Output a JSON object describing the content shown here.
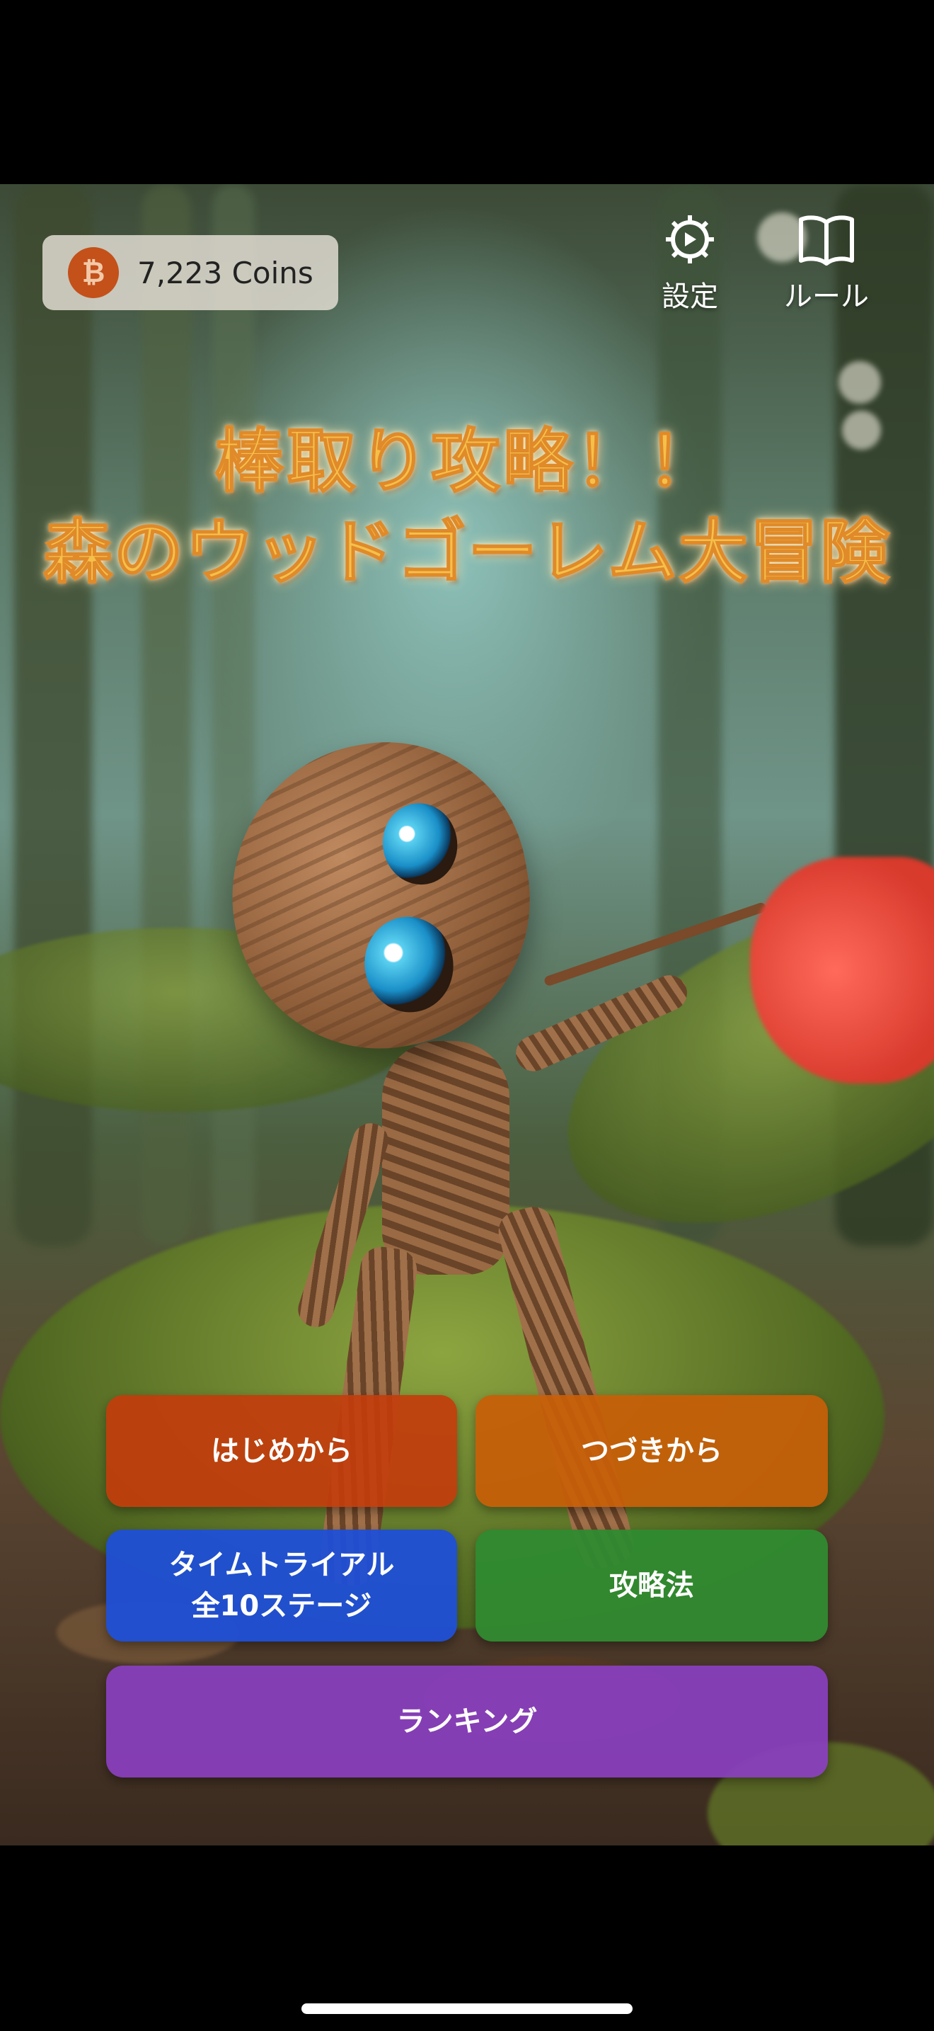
{
  "hud": {
    "coin_icon_symbol": "₿",
    "coins_text": "7,223 Coins",
    "settings_label": "設定",
    "rules_label": "ルール"
  },
  "title": {
    "line1": "棒取り攻略！！",
    "line2": "森のウッドゴーレム大冒険"
  },
  "menu": {
    "start": "はじめから",
    "continue": "つづきから",
    "time_trial_line1": "タイムトライアル",
    "time_trial_line2": "全10ステージ",
    "strategy": "攻略法",
    "ranking": "ランキング"
  },
  "colors": {
    "start": "#c23d0c",
    "continue": "#c85e08",
    "time_trial": "#1f4fd6",
    "strategy": "#2f8a2f",
    "ranking": "#8a3fc0",
    "title": "#f5c04a"
  }
}
